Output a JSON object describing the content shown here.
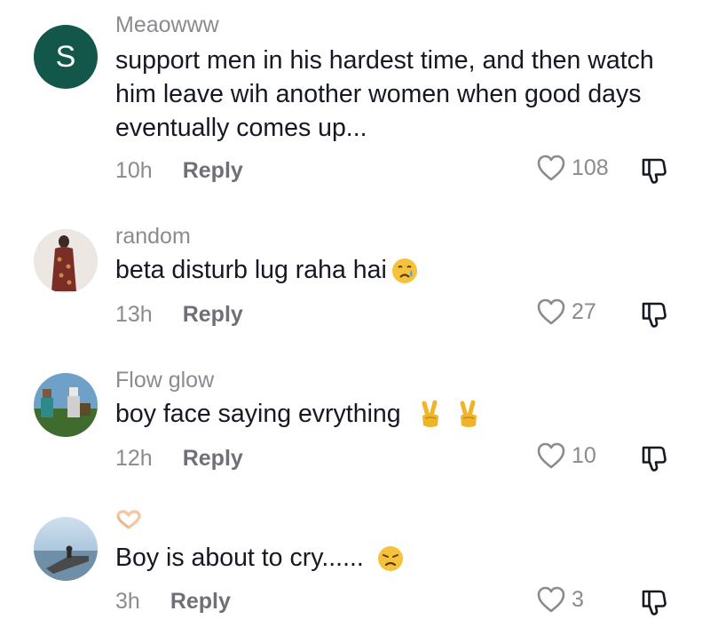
{
  "comments": [
    {
      "avatar_letter": "S",
      "username": "Meaowww",
      "text": "support men in his hardest time, and then watch him leave wih another women when good days eventually comes up...",
      "time": "10h",
      "reply_label": "Reply",
      "likes": "108"
    },
    {
      "username": "random",
      "text": "beta disturb lug raha hai",
      "time": "13h",
      "reply_label": "Reply",
      "likes": "27"
    },
    {
      "username": "Flow glow",
      "text": "boy face saying evrything",
      "time": "12h",
      "reply_label": "Reply",
      "likes": "10"
    },
    {
      "username": "",
      "text": "Boy is about to cry......",
      "time": "3h",
      "reply_label": "Reply",
      "likes": "3"
    }
  ],
  "icons": {
    "like": "heart-outline-icon",
    "dislike": "thumbs-down-icon",
    "crying_emoji": "crying-face-emoji",
    "peace_emoji": "victory-hand-emoji",
    "disappointed_emoji": "disappointed-face-emoji",
    "username_emoji": "heart-hands-emoji"
  },
  "colors": {
    "avatar_green": "#12574a",
    "muted_text": "#8a8b91",
    "primary_text": "#161823"
  }
}
